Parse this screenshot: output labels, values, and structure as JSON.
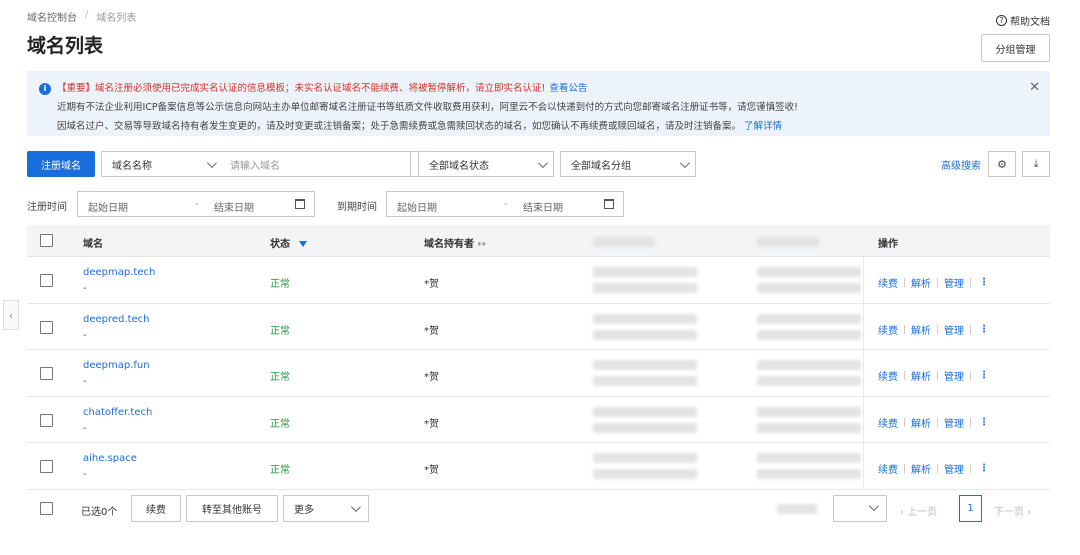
{
  "breadcrumb": {
    "root": "域名控制台",
    "sep": "/",
    "current": "域名列表"
  },
  "header": {
    "title": "域名列表",
    "help": "帮助文档",
    "help_icon": "?",
    "group_button": "分组管理"
  },
  "notice": {
    "line1_tag": "【重要】域名注册必须使用已完成实名认证的信息模板；未实名认证域名不能续费、将被暂停解析，请立即实名认证!",
    "line1_link": "查看公告",
    "line2": "近期有不法企业利用ICP备案信息等公示信息向网站主办单位邮寄域名注册证书等纸质文件收取费用获利，阿里云不会以快递到付的方式向您邮寄域名注册证书等，请您谨慎签收!",
    "line3": "因域名过户、交易等导致域名持有者发生变更的，请及时变更或注销备案；处于急需续费或急需赎回状态的域名，如您确认不再续费或赎回域名，请及时注销备案。",
    "line3_link": "了解详情",
    "info_icon": "i",
    "close_icon": "✕"
  },
  "toolbar": {
    "register": "注册域名",
    "search_type": "域名名称",
    "search_placeholder": "请输入域名",
    "status_filter": "全部域名状态",
    "group_filter": "全部域名分组",
    "advanced": "高级搜索",
    "settings_icon": "⚙",
    "download_icon": "⤓"
  },
  "filters": {
    "reg_label": "注册时间",
    "exp_label": "到期时间",
    "start_placeholder": "起始日期",
    "end_placeholder": "结束日期",
    "range_sep": "-"
  },
  "table": {
    "columns": {
      "domain": "域名",
      "status": "状态",
      "holder": "域名持有者",
      "holder_icon": "↔",
      "ops": "操作"
    },
    "ops_labels": {
      "renew": "续费",
      "dns": "解析",
      "manage": "管理",
      "more": "⋮"
    },
    "rows": [
      {
        "domain": "deepmap.tech",
        "sub": "-",
        "status": "正常",
        "holder": "*贺"
      },
      {
        "domain": "deepred.tech",
        "sub": "-",
        "status": "正常",
        "holder": "*贺"
      },
      {
        "domain": "deepmap.fun",
        "sub": "-",
        "status": "正常",
        "holder": "*贺"
      },
      {
        "domain": "chatoffer.tech",
        "sub": "-",
        "status": "正常",
        "holder": "*贺"
      },
      {
        "domain": "aihe.space",
        "sub": "-",
        "status": "正常",
        "holder": "*贺"
      }
    ]
  },
  "footer": {
    "selected": "已选0个",
    "renew": "续费",
    "transfer": "转至其他账号",
    "more": "更多",
    "prev": "上一页",
    "page": "1",
    "next": "下一页"
  },
  "colors": {
    "primary": "#1a6edb",
    "success": "#1e9a3a",
    "danger": "#d93026",
    "notice_bg": "#edf3fa"
  }
}
